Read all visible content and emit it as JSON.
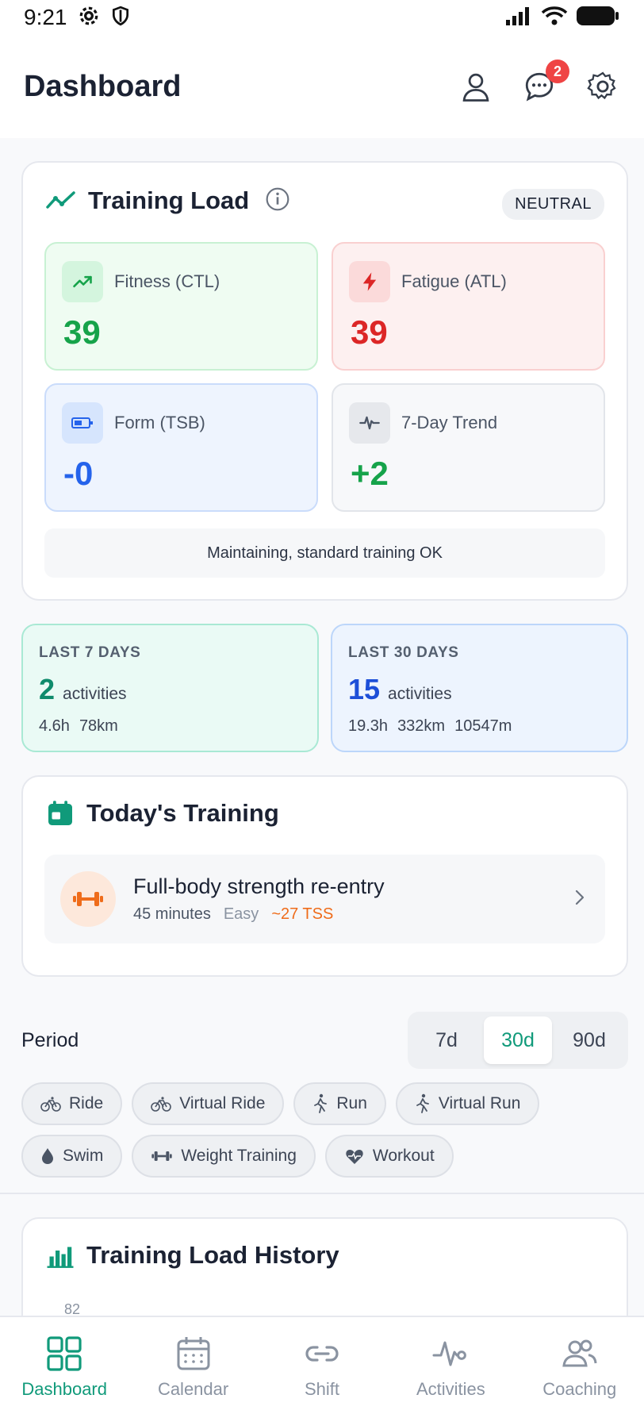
{
  "status_bar": {
    "time": "9:21"
  },
  "header": {
    "title": "Dashboard",
    "messages_badge": "2"
  },
  "training_load": {
    "title": "Training Load",
    "state": "NEUTRAL",
    "fitness": {
      "label": "Fitness (CTL)",
      "value": "39",
      "color": "#16a34a"
    },
    "fatigue": {
      "label": "Fatigue (ATL)",
      "value": "39",
      "color": "#dc2626"
    },
    "form": {
      "label": "Form (TSB)",
      "value": "-0",
      "color": "#2563eb"
    },
    "trend": {
      "label": "7-Day Trend",
      "value": "+2",
      "color": "#16a34a"
    },
    "note": "Maintaining, standard training OK"
  },
  "last7": {
    "label": "LAST 7 DAYS",
    "count": "2",
    "unit": "activities",
    "hours": "4.6h",
    "distance": "78km"
  },
  "last30": {
    "label": "LAST 30 DAYS",
    "count": "15",
    "unit": "activities",
    "hours": "19.3h",
    "distance": "332km",
    "elevation": "10547m"
  },
  "today": {
    "title": "Today's Training",
    "workout": {
      "name": "Full-body strength re-entry",
      "duration": "45 minutes",
      "level": "Easy",
      "tss": "~27 TSS"
    }
  },
  "period": {
    "label": "Period",
    "options": [
      "7d",
      "30d",
      "90d"
    ],
    "selected": "30d"
  },
  "filters": [
    "Ride",
    "Virtual Ride",
    "Run",
    "Virtual Run",
    "Swim",
    "Weight Training",
    "Workout"
  ],
  "history": {
    "title": "Training Load History",
    "top_tick": "82"
  },
  "nav": {
    "items": [
      "Dashboard",
      "Calendar",
      "Shift",
      "Activities",
      "Coaching"
    ],
    "active": "Dashboard"
  },
  "colors": {
    "accent": "#109a7a"
  }
}
